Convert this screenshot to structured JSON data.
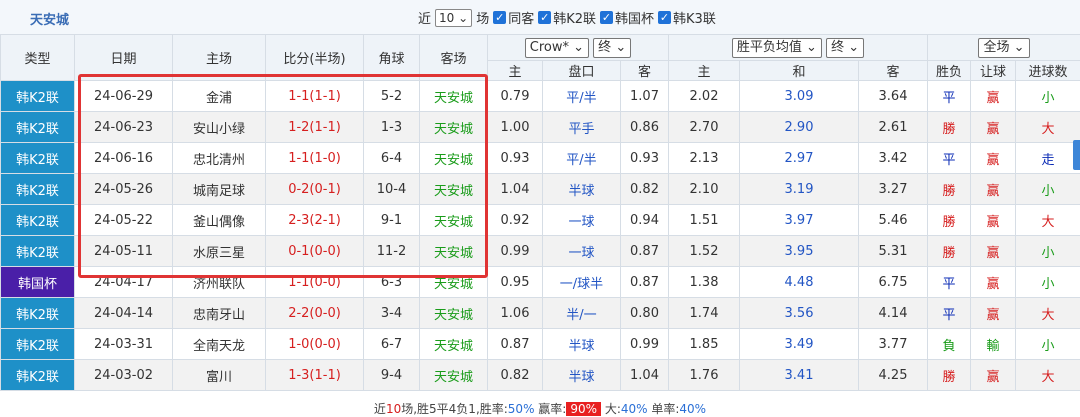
{
  "team_title": "天安城",
  "filter": {
    "prefix": "近",
    "count": "10",
    "suffix": "场",
    "same_host": "同客",
    "leagues": [
      "韩K2联",
      "韩国杯",
      "韩K3联"
    ]
  },
  "columns": {
    "type": "类型",
    "date": "日期",
    "home": "主场",
    "score": "比分(半场)",
    "corner": "角球",
    "away": "客场",
    "company": "Crow*",
    "period": "终",
    "odds_type": "胜平负均值",
    "odds_period": "终",
    "range": "全场",
    "sub_home": "主",
    "sub_handicap": "盘口",
    "sub_away": "客",
    "sub_win": "主",
    "sub_draw": "和",
    "sub_lose": "客",
    "sub_result": "胜负",
    "sub_ah": "让球",
    "sub_ou": "进球数"
  },
  "rows": [
    {
      "type": "韩K2联",
      "date": "24-06-29",
      "home": "金浦",
      "score": "1-1(1-1)",
      "corner": "5-2",
      "away": "天安城",
      "h": "0.79",
      "pan": "平/半",
      "a": "1.07",
      "w": "2.02",
      "d": "3.09",
      "l": "3.64",
      "res": "平",
      "ah": "赢",
      "ou": "小"
    },
    {
      "type": "韩K2联",
      "date": "24-06-23",
      "home": "安山小绿",
      "score": "1-2(1-1)",
      "corner": "1-3",
      "away": "天安城",
      "h": "1.00",
      "pan": "平手",
      "a": "0.86",
      "w": "2.70",
      "d": "2.90",
      "l": "2.61",
      "res": "勝",
      "ah": "赢",
      "ou": "大"
    },
    {
      "type": "韩K2联",
      "date": "24-06-16",
      "home": "忠北清州",
      "score": "1-1(1-0)",
      "corner": "6-4",
      "away": "天安城",
      "h": "0.93",
      "pan": "平/半",
      "a": "0.93",
      "w": "2.13",
      "d": "2.97",
      "l": "3.42",
      "res": "平",
      "ah": "赢",
      "ou": "走"
    },
    {
      "type": "韩K2联",
      "date": "24-05-26",
      "home": "城南足球",
      "score": "0-2(0-1)",
      "corner": "10-4",
      "away": "天安城",
      "h": "1.04",
      "pan": "半球",
      "a": "0.82",
      "w": "2.10",
      "d": "3.19",
      "l": "3.27",
      "res": "勝",
      "ah": "赢",
      "ou": "小"
    },
    {
      "type": "韩K2联",
      "date": "24-05-22",
      "home": "釜山偶像",
      "score": "2-3(2-1)",
      "corner": "9-1",
      "away": "天安城",
      "h": "0.92",
      "pan": "一球",
      "a": "0.94",
      "w": "1.51",
      "d": "3.97",
      "l": "5.46",
      "res": "勝",
      "ah": "赢",
      "ou": "大"
    },
    {
      "type": "韩K2联",
      "date": "24-05-11",
      "home": "水原三星",
      "score": "0-1(0-0)",
      "corner": "11-2",
      "away": "天安城",
      "h": "0.99",
      "pan": "一球",
      "a": "0.87",
      "w": "1.52",
      "d": "3.95",
      "l": "5.31",
      "res": "勝",
      "ah": "赢",
      "ou": "小"
    },
    {
      "type": "韩国杯",
      "date": "24-04-17",
      "home": "济州联队",
      "score": "1-1(0-0)",
      "corner": "6-3",
      "away": "天安城",
      "h": "0.95",
      "pan": "一/球半",
      "a": "0.87",
      "w": "1.38",
      "d": "4.48",
      "l": "6.75",
      "res": "平",
      "ah": "赢",
      "ou": "小"
    },
    {
      "type": "韩K2联",
      "date": "24-04-14",
      "home": "忠南牙山",
      "score": "2-2(0-0)",
      "corner": "3-4",
      "away": "天安城",
      "h": "1.06",
      "pan": "半/一",
      "a": "0.80",
      "w": "1.74",
      "d": "3.56",
      "l": "4.14",
      "res": "平",
      "ah": "赢",
      "ou": "大"
    },
    {
      "type": "韩K2联",
      "date": "24-03-31",
      "home": "全南天龙",
      "score": "1-0(0-0)",
      "corner": "6-7",
      "away": "天安城",
      "h": "0.87",
      "pan": "半球",
      "a": "0.99",
      "w": "1.85",
      "d": "3.49",
      "l": "3.77",
      "res": "負",
      "ah": "輸",
      "ou": "小"
    },
    {
      "type": "韩K2联",
      "date": "24-03-02",
      "home": "富川",
      "score": "1-3(1-1)",
      "corner": "9-4",
      "away": "天安城",
      "h": "0.82",
      "pan": "半球",
      "a": "1.04",
      "w": "1.76",
      "d": "3.41",
      "l": "4.25",
      "res": "勝",
      "ah": "赢",
      "ou": "大"
    }
  ],
  "footer": {
    "p1": "近",
    "n": "10",
    "p2": "场,胜5平4负1,胜率:",
    "win_rate": "50%",
    "p3": " 赢率:",
    "ah_rate": "90%",
    "p4": " 大:",
    "big_rate": "40%",
    "p5": " 单率:",
    "odd_rate": "40%"
  },
  "colors": {
    "league_bg": "#1e90c8",
    "cup_bg": "#4a1fa8",
    "highlight_border": "#e03434",
    "red": "#d61f1f",
    "green": "#1a9c1a",
    "blue": "#2255c4"
  }
}
